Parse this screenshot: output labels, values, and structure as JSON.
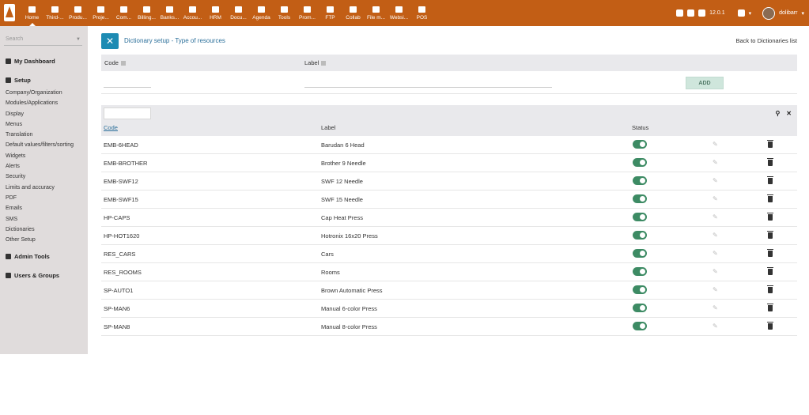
{
  "topbar": {
    "menu": [
      {
        "label": "Home",
        "icon": "home-icon"
      },
      {
        "label": "Third-...",
        "icon": "building-icon"
      },
      {
        "label": "Produ...",
        "icon": "cube-icon"
      },
      {
        "label": "Proje...",
        "icon": "sitemap-icon"
      },
      {
        "label": "Com...",
        "icon": "suitcase-icon"
      },
      {
        "label": "Billing...",
        "icon": "invoice-icon"
      },
      {
        "label": "Banks...",
        "icon": "bank-icon"
      },
      {
        "label": "Accou...",
        "icon": "calculator-icon"
      },
      {
        "label": "HRM",
        "icon": "user-icon"
      },
      {
        "label": "Docu...",
        "icon": "folder-icon"
      },
      {
        "label": "Agenda",
        "icon": "calendar-icon"
      },
      {
        "label": "Tools",
        "icon": "wrench-icon"
      },
      {
        "label": "Prom...",
        "icon": "promo-icon"
      },
      {
        "label": "FTP",
        "icon": "transfer-icon"
      },
      {
        "label": "Collab",
        "icon": "comments-icon"
      },
      {
        "label": "File m...",
        "icon": "file-icon"
      },
      {
        "label": "Websi...",
        "icon": "globe-icon"
      },
      {
        "label": "POS",
        "icon": "cash-register-icon"
      }
    ],
    "version": "12.0.1",
    "username": "dolibarr"
  },
  "sidebar": {
    "search_placeholder": "Search",
    "my_dashboard": "My Dashboard",
    "setup": "Setup",
    "links": [
      "Company/Organization",
      "Modules/Applications",
      "Display",
      "Menus",
      "Translation",
      "Default values/filters/sorting",
      "Widgets",
      "Alerts",
      "Security",
      "Limits and accuracy",
      "PDF",
      "Emails",
      "SMS",
      "Dictionaries",
      "Other Setup"
    ],
    "admin_tools": "Admin Tools",
    "users_groups": "Users & Groups"
  },
  "main": {
    "title": "Dictionary setup - Type of resources",
    "back_link": "Back to Dictionaries list",
    "form": {
      "code_label": "Code",
      "label_label": "Label",
      "add_button": "ADD"
    },
    "table": {
      "headers": {
        "code": "Code",
        "label": "Label",
        "status": "Status"
      },
      "rows": [
        {
          "code": "EMB-6HEAD",
          "label": "Barudan 6 Head",
          "active": true
        },
        {
          "code": "EMB-BROTHER",
          "label": "Brother 9 Needle",
          "active": true
        },
        {
          "code": "EMB-SWF12",
          "label": "SWF 12 Needle",
          "active": true
        },
        {
          "code": "EMB-SWF15",
          "label": "SWF 15 Needle",
          "active": true
        },
        {
          "code": "HP-CAPS",
          "label": "Cap Heat Press",
          "active": true
        },
        {
          "code": "HP-HOT1620",
          "label": "Hotronix 16x20 Press",
          "active": true
        },
        {
          "code": "RES_CARS",
          "label": "Cars",
          "active": true
        },
        {
          "code": "RES_ROOMS",
          "label": "Rooms",
          "active": true
        },
        {
          "code": "SP-AUTO1",
          "label": "Brown Automatic Press",
          "active": true
        },
        {
          "code": "SP-MAN6",
          "label": "Manual 6-color Press",
          "active": true
        },
        {
          "code": "SP-MAN8",
          "label": "Manual 8-color Press",
          "active": true
        }
      ]
    }
  },
  "colors": {
    "topbar": "#c25e15",
    "sidebar": "#e0dcdc",
    "toggle_on": "#3d8b64",
    "link": "#2b6f9a"
  }
}
